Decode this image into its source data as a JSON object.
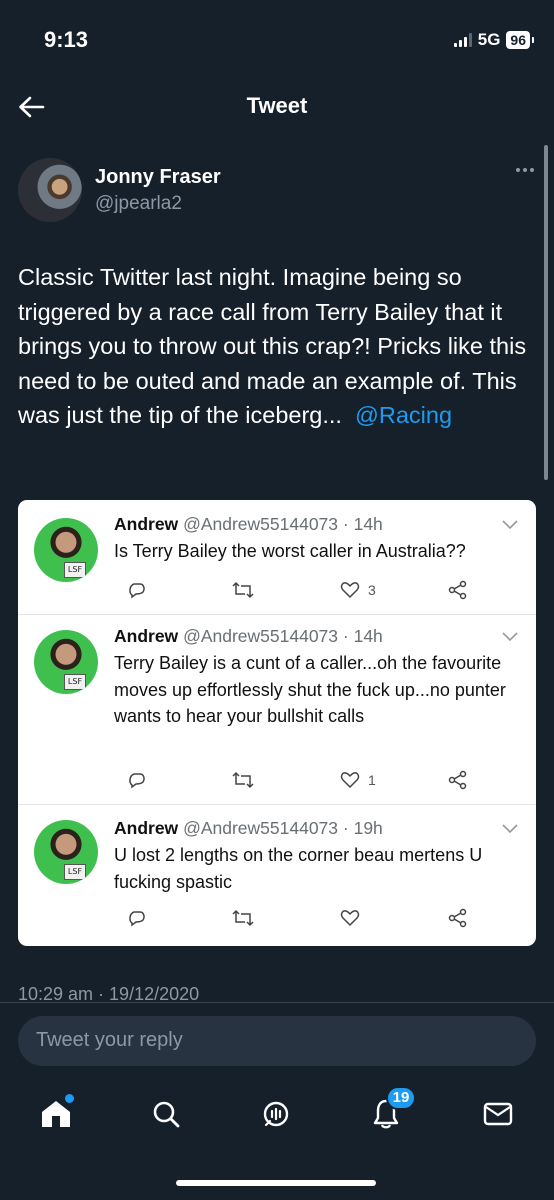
{
  "status": {
    "time": "9:13",
    "network": "5G",
    "battery": "96"
  },
  "header": {
    "title": "Tweet"
  },
  "tweet": {
    "author_name": "Jonny Fraser",
    "author_handle": "@jpearla2",
    "text": "Classic Twitter last night. Imagine being so triggered by a race call from Terry Bailey that it brings you to throw out this crap?! Pricks like this need to be outed and made an example of. This was just the tip of the iceberg...",
    "mention": "@Racing",
    "timestamp": "10:29 am · 19/12/2020"
  },
  "embedded_replies": [
    {
      "name": "Andrew",
      "handle": "@Andrew55144073",
      "time": "· 14h",
      "text": "Is Terry Bailey the worst caller in Australia??",
      "likes": "3",
      "avatar_tag": "LSF"
    },
    {
      "name": "Andrew",
      "handle": "@Andrew55144073",
      "time": "· 14h",
      "text": "Terry Bailey is a cunt of a caller...oh the favourite moves up effortlessly shut the fuck up...no punter wants to hear your bullshit calls",
      "likes": "1",
      "avatar_tag": "LSF"
    },
    {
      "name": "Andrew",
      "handle": "@Andrew55144073",
      "time": "· 19h",
      "text": "U lost 2 lengths on the corner beau mertens U fucking spastic",
      "likes": "",
      "avatar_tag": "LSF"
    }
  ],
  "composer": {
    "placeholder": "Tweet your reply"
  },
  "tabbar": {
    "notifications_badge": "19"
  },
  "icons": {
    "back": "back-arrow-icon",
    "more": "more-icon",
    "reply": "reply-icon",
    "retweet": "retweet-icon",
    "like": "like-icon",
    "share": "share-icon",
    "home": "home-icon",
    "search": "search-icon",
    "spaces": "spaces-icon",
    "notifications": "bell-icon",
    "messages": "mail-icon"
  },
  "colors": {
    "background": "#15202b",
    "accent": "#1d9bf0",
    "muted": "#8b98a5"
  }
}
